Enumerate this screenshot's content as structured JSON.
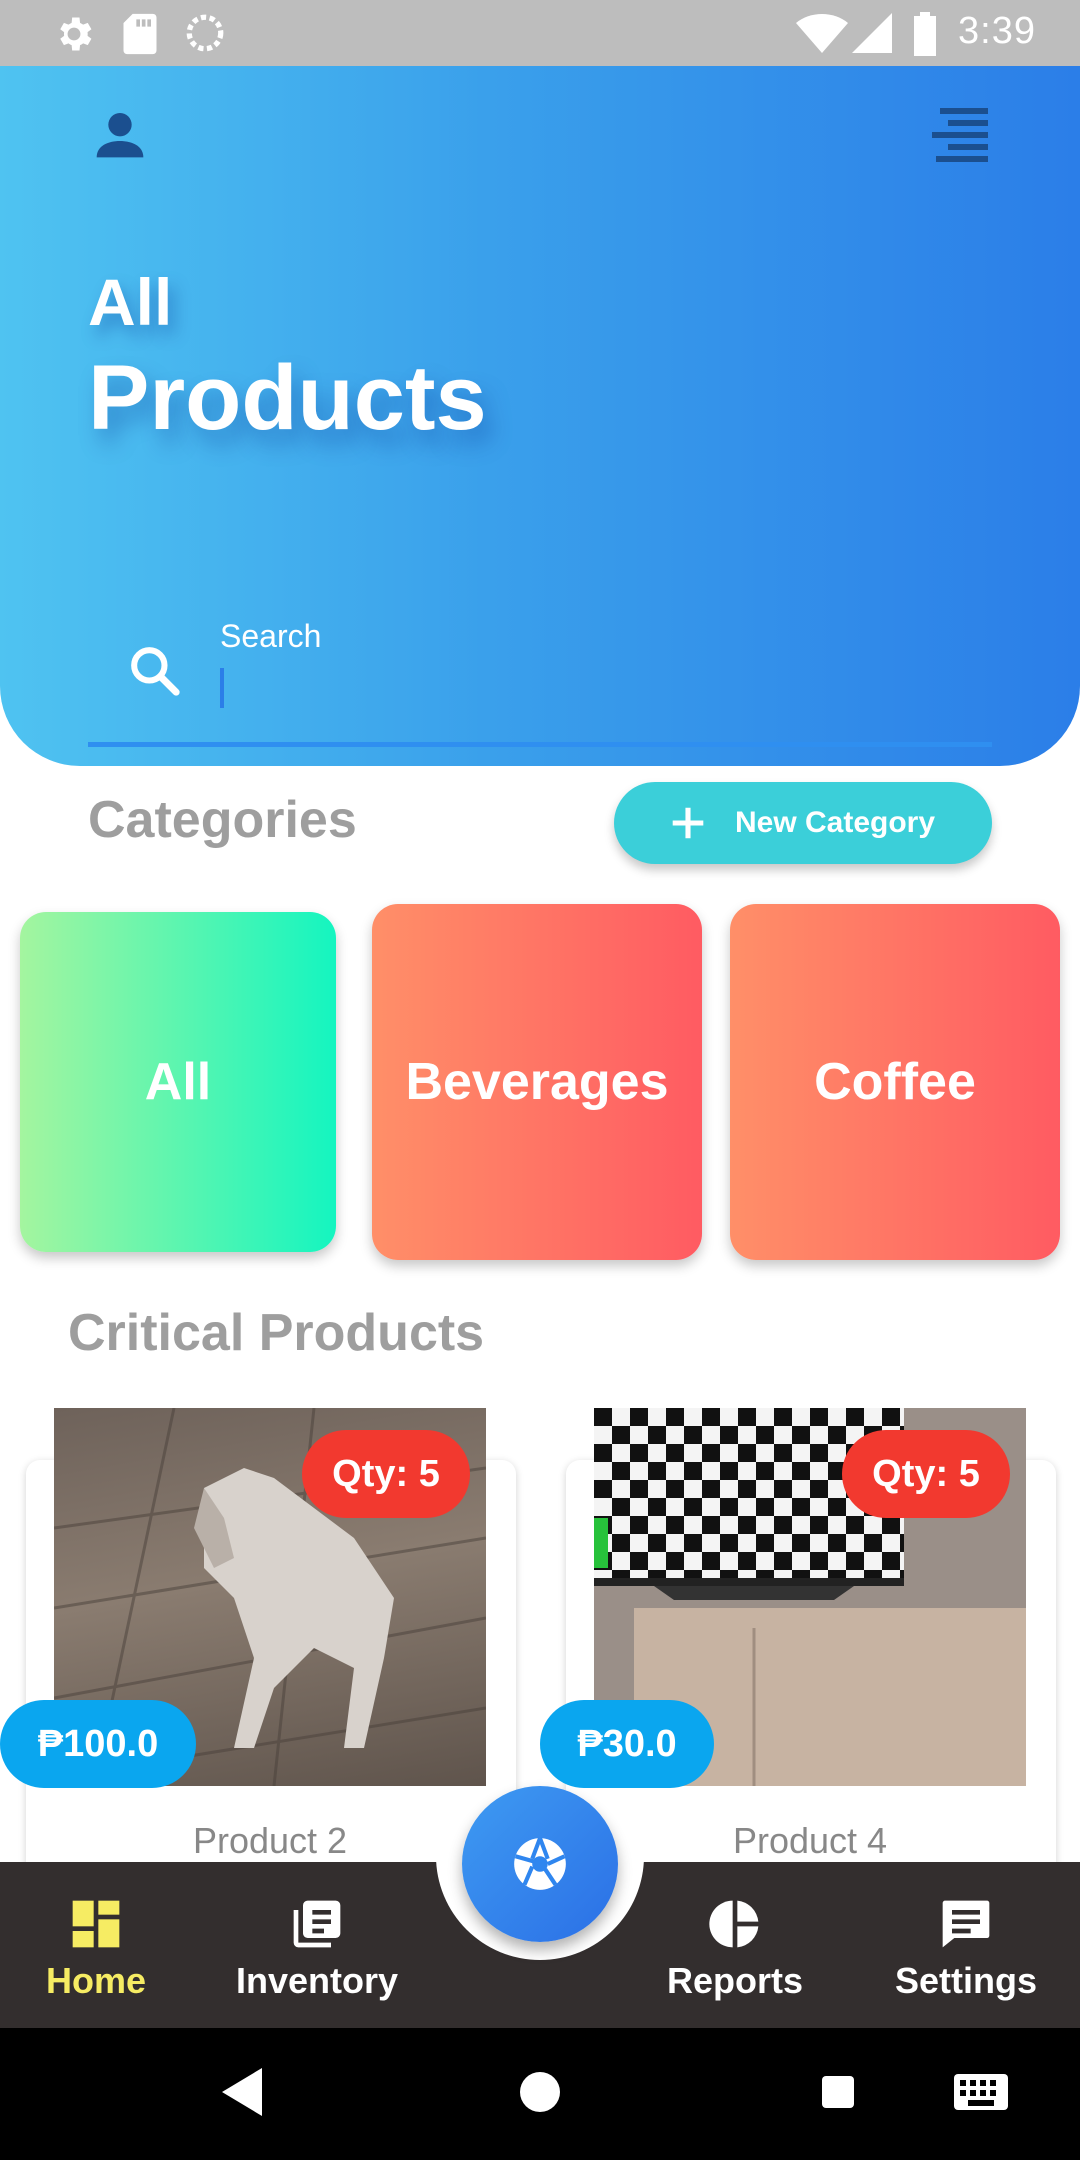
{
  "status_bar": {
    "time": "3:39",
    "icons": [
      "settings-icon",
      "sd-card-icon",
      "sync-icon",
      "wifi-icon",
      "signal-icon",
      "battery-icon"
    ]
  },
  "header": {
    "subtitle": "All",
    "title": "Products",
    "search": {
      "label": "Search"
    },
    "colors": {
      "gradient_start": "#4fc3f1",
      "gradient_end": "#2b7ee8"
    }
  },
  "categories": {
    "title": "Categories",
    "new_button": "New Category",
    "items": [
      {
        "label": "All",
        "colors": [
          "#a4f59f",
          "#14f5c0"
        ]
      },
      {
        "label": "Beverages",
        "colors": [
          "#ff8f68",
          "#ff5b62"
        ]
      },
      {
        "label": "Coffee",
        "colors": [
          "#ff8f68",
          "#ff5b62"
        ]
      }
    ]
  },
  "critical": {
    "title": "Critical Products",
    "products": [
      {
        "name": "Product 2",
        "qty": "Qty: 5",
        "price": "₱100.0",
        "image": "cat-photo"
      },
      {
        "name": "Product 4",
        "qty": "Qty: 5",
        "price": "₱30.0",
        "image": "tv-checkerboard-photo"
      }
    ]
  },
  "bottom_nav": {
    "items": [
      {
        "label": "Home",
        "icon": "dashboard-icon",
        "active": true
      },
      {
        "label": "Inventory",
        "icon": "inventory-list-icon",
        "active": false
      },
      {
        "label": "Reports",
        "icon": "pie-chart-icon",
        "active": false
      },
      {
        "label": "Settings",
        "icon": "message-icon",
        "active": false
      }
    ],
    "fab_icon": "camera-shutter-icon",
    "active_color": "#f6ec63"
  },
  "system_nav": [
    "back-icon",
    "home-icon",
    "recents-icon",
    "keyboard-icon"
  ]
}
